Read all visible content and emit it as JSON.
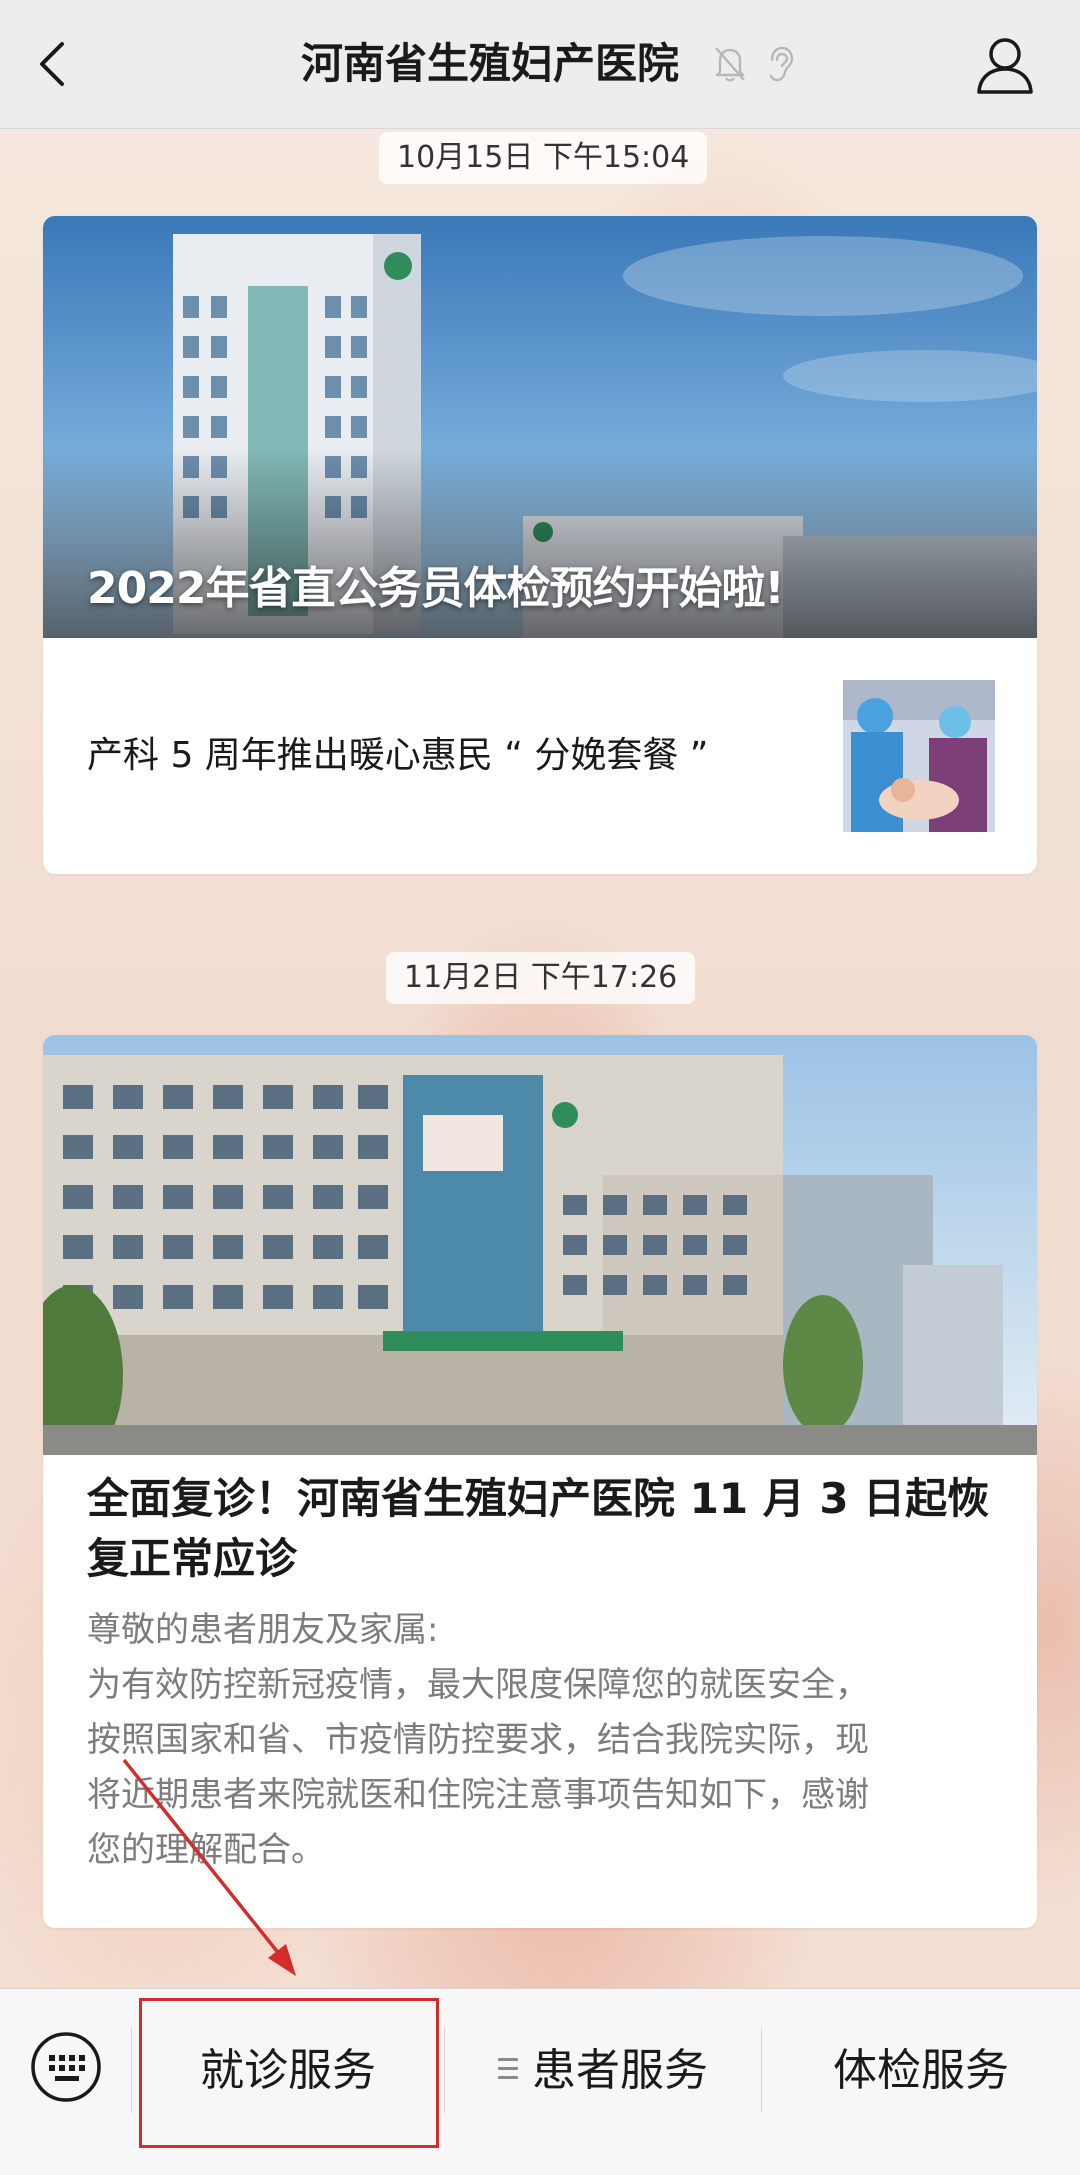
{
  "header": {
    "title": "河南省生殖妇产医院",
    "back_icon": "chevron-left-icon",
    "mute_icon": "bell-off-icon",
    "ear_icon": "ear-icon",
    "profile_icon": "person-icon"
  },
  "messages": [
    {
      "timestamp": "10月15日 下午15:04",
      "hero_title": "2022年省直公务员体检预约开始啦!",
      "sub_article_title": "产科 5 周年推出暖心惠民 “ 分娩套餐 ”"
    },
    {
      "timestamp": "11月2日 下午17:26",
      "title": "全面复诊！河南省生殖妇产医院 11 月 3 日起恢复正常应诊",
      "body_lines": [
        "尊敬的患者朋友及家属:",
        "为有效防控新冠疫情，最大限度保障您的就医安全，",
        "按照国家和省、市疫情防控要求，结合我院实际，现",
        "将近期患者来院就医和住院注意事项告知如下，感谢",
        "您的理解配合。"
      ]
    }
  ],
  "menu": {
    "keyboard_icon": "keyboard-icon",
    "items": [
      {
        "label": "就诊服务"
      },
      {
        "label": "患者服务",
        "icon": "menu-lines-icon"
      },
      {
        "label": "体检服务"
      }
    ]
  },
  "annotation": {
    "color": "#d42b2b"
  }
}
